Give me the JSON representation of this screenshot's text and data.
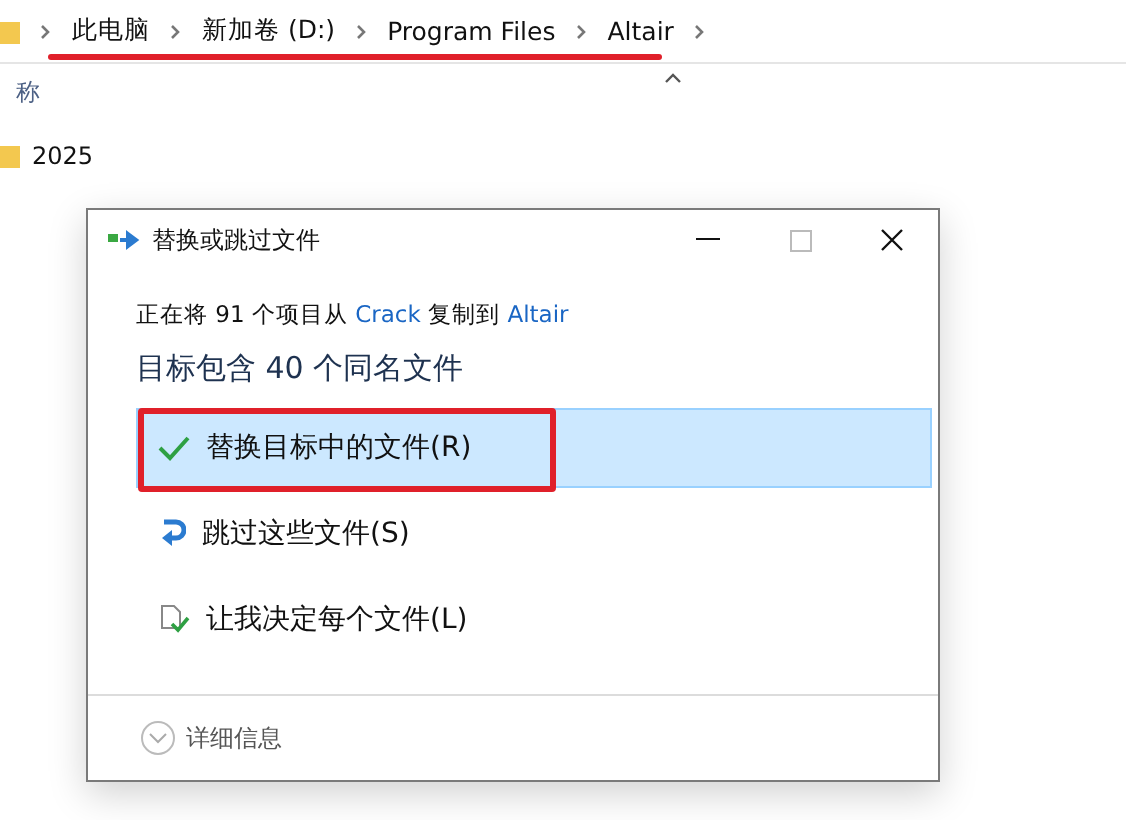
{
  "breadcrumb": {
    "underlined": true,
    "items": [
      {
        "label": "此电脑"
      },
      {
        "label": "新加卷 (D:)"
      },
      {
        "label": "Program Files"
      },
      {
        "label": "Altair"
      }
    ]
  },
  "file_list": {
    "column_header": "称",
    "rows": [
      {
        "name": "2025"
      }
    ]
  },
  "dialog": {
    "title": "替换或跳过文件",
    "message": {
      "prefix": "正在将 91 个项目从",
      "source": "Crack",
      "middle": "复制到",
      "target": "Altair"
    },
    "heading": "目标包含 40 个同名文件",
    "options": [
      {
        "kind": "replace",
        "label": "替换目标中的文件(R)",
        "selected": true,
        "highlighted": true
      },
      {
        "kind": "skip",
        "label": "跳过这些文件(S)",
        "selected": false,
        "highlighted": false
      },
      {
        "kind": "decide",
        "label": "让我决定每个文件(L)",
        "selected": false,
        "highlighted": false
      }
    ],
    "details": "详细信息"
  }
}
